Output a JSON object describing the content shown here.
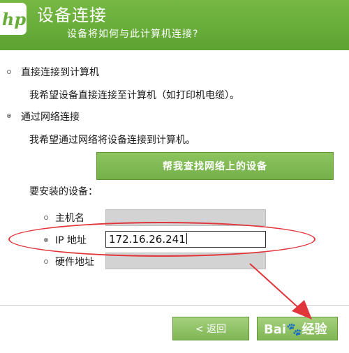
{
  "header": {
    "logo": "hp",
    "title": "设备连接",
    "subtitle": "设备将如何与此计算机连接?"
  },
  "options": {
    "direct": {
      "label": "直接连接到计算机",
      "desc": "我希望设备直接连接至计算机（如打印机电缆）。",
      "selected": false
    },
    "network": {
      "label": "通过网络连接",
      "desc": "我希望通过网络将设备连接到计算机。",
      "selected": true
    }
  },
  "find_button_label": "帮我查找网络上的设备",
  "install_label": "要安装的设备：",
  "device_fields": {
    "hostname": {
      "label": "主机名",
      "value": "",
      "selected": false
    },
    "ip": {
      "label": "IP 地址",
      "value": "172.16.26.241",
      "selected": true
    },
    "hardware": {
      "label": "硬件地址",
      "value": "",
      "selected": false
    }
  },
  "footer": {
    "back_label": "< 返回",
    "watermark": "Bai🐾经验"
  },
  "colors": {
    "header_green": "#67ad38",
    "button_green": "#7fb655",
    "annotation_red": "#e0353a"
  }
}
